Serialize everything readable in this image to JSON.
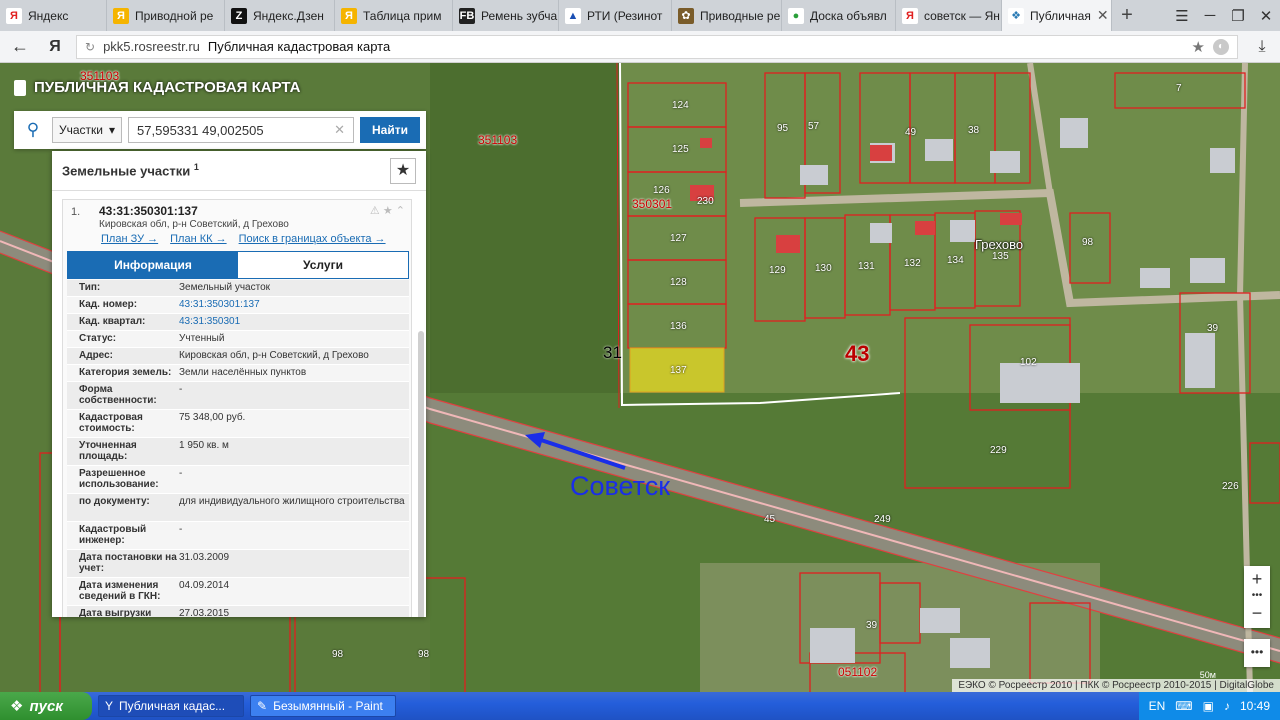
{
  "browser": {
    "tabs": [
      {
        "label": "Яндекс",
        "icon": "yandex-icon"
      },
      {
        "label": "Приводной ре",
        "icon": "ya-market-icon"
      },
      {
        "label": "Яндекс.Дзен",
        "icon": "zen-icon"
      },
      {
        "label": "Таблица прим",
        "icon": "ya-market-icon"
      },
      {
        "label": "Ремень зубча",
        "icon": "fb-icon"
      },
      {
        "label": "РТИ (Резинот",
        "icon": "rti-icon"
      },
      {
        "label": "Приводные ре",
        "icon": "drive-icon"
      },
      {
        "label": "Доска объявл",
        "icon": "avito-icon"
      },
      {
        "label": "советск — Ян",
        "icon": "yandex-icon"
      },
      {
        "label": "Публичная",
        "icon": "pkk-icon",
        "active": true
      }
    ],
    "address": {
      "host": "pkk5.rosreestr.ru",
      "page_title": "Публичная кадастровая карта"
    }
  },
  "app": {
    "title": "ПУБЛИЧНАЯ КАДАСТРОВАЯ КАРТА"
  },
  "search": {
    "type_label": "Участки",
    "query": "57,595331 49,002505",
    "button": "Найти"
  },
  "panel": {
    "title": "Земельные участки",
    "count_sup": "1",
    "item": {
      "index": "1.",
      "cad_number": "43:31:350301:137",
      "address": "Кировская обл, р-н Советский, д Грехово",
      "links": [
        "План ЗУ →",
        "План КК →",
        "Поиск в границах объекта →"
      ],
      "tabs": [
        "Информация",
        "Услуги"
      ],
      "rows": [
        {
          "k": "Тип:",
          "v": "Земельный участок"
        },
        {
          "k": "Кад. номер:",
          "v": "43:31:350301:137",
          "link": true
        },
        {
          "k": "Кад. квартал:",
          "v": "43:31:350301",
          "link": true
        },
        {
          "k": "Статус:",
          "v": "Учтенный"
        },
        {
          "k": "Адрес:",
          "v": "Кировская обл, р-н Советский, д Грехово"
        },
        {
          "k": "Категория земель:",
          "v": "Земли населённых пунктов"
        },
        {
          "k": "Форма собственности:",
          "v": "-"
        },
        {
          "k": "Кадастровая стоимость:",
          "v": "75 348,00 руб."
        },
        {
          "k": "Уточненная площадь:",
          "v": "1 950 кв. м"
        },
        {
          "k": "Разрешенное использование:",
          "v": "-"
        },
        {
          "k": "по документу:",
          "v": "для индивидуального жилищного строительства"
        },
        {
          "k": "Кадастровый инженер:",
          "v": "-"
        },
        {
          "k": "Дата постановки на учет:",
          "v": "31.03.2009"
        },
        {
          "k": "Дата изменения сведений в ГКН:",
          "v": "04.09.2014"
        },
        {
          "k": "Дата выгрузки",
          "v": "27.03.2015"
        }
      ]
    }
  },
  "map": {
    "labels": [
      "351103",
      "351103",
      "124",
      "125",
      "126",
      "230",
      "350301",
      "127",
      "128",
      "136",
      "137",
      "31",
      "129",
      "130",
      "131",
      "132",
      "134",
      "135",
      "98",
      "102",
      "39",
      "229",
      "7",
      "95",
      "57",
      "49",
      "38",
      "43",
      "45",
      "249",
      "39",
      "051102",
      "98",
      "98",
      "226"
    ],
    "village": "Грехово",
    "annotation": "Советск",
    "attribution": "ЕЭКО © Росреестр 2010 | ПКК © Росреестр 2010-2015 | DigitalGlobe",
    "scale": "50м"
  },
  "taskbar": {
    "start": "пуск",
    "items": [
      "Публичная кадас...",
      "Безымянный - Paint"
    ],
    "lang": "EN",
    "clock": "10:49"
  }
}
